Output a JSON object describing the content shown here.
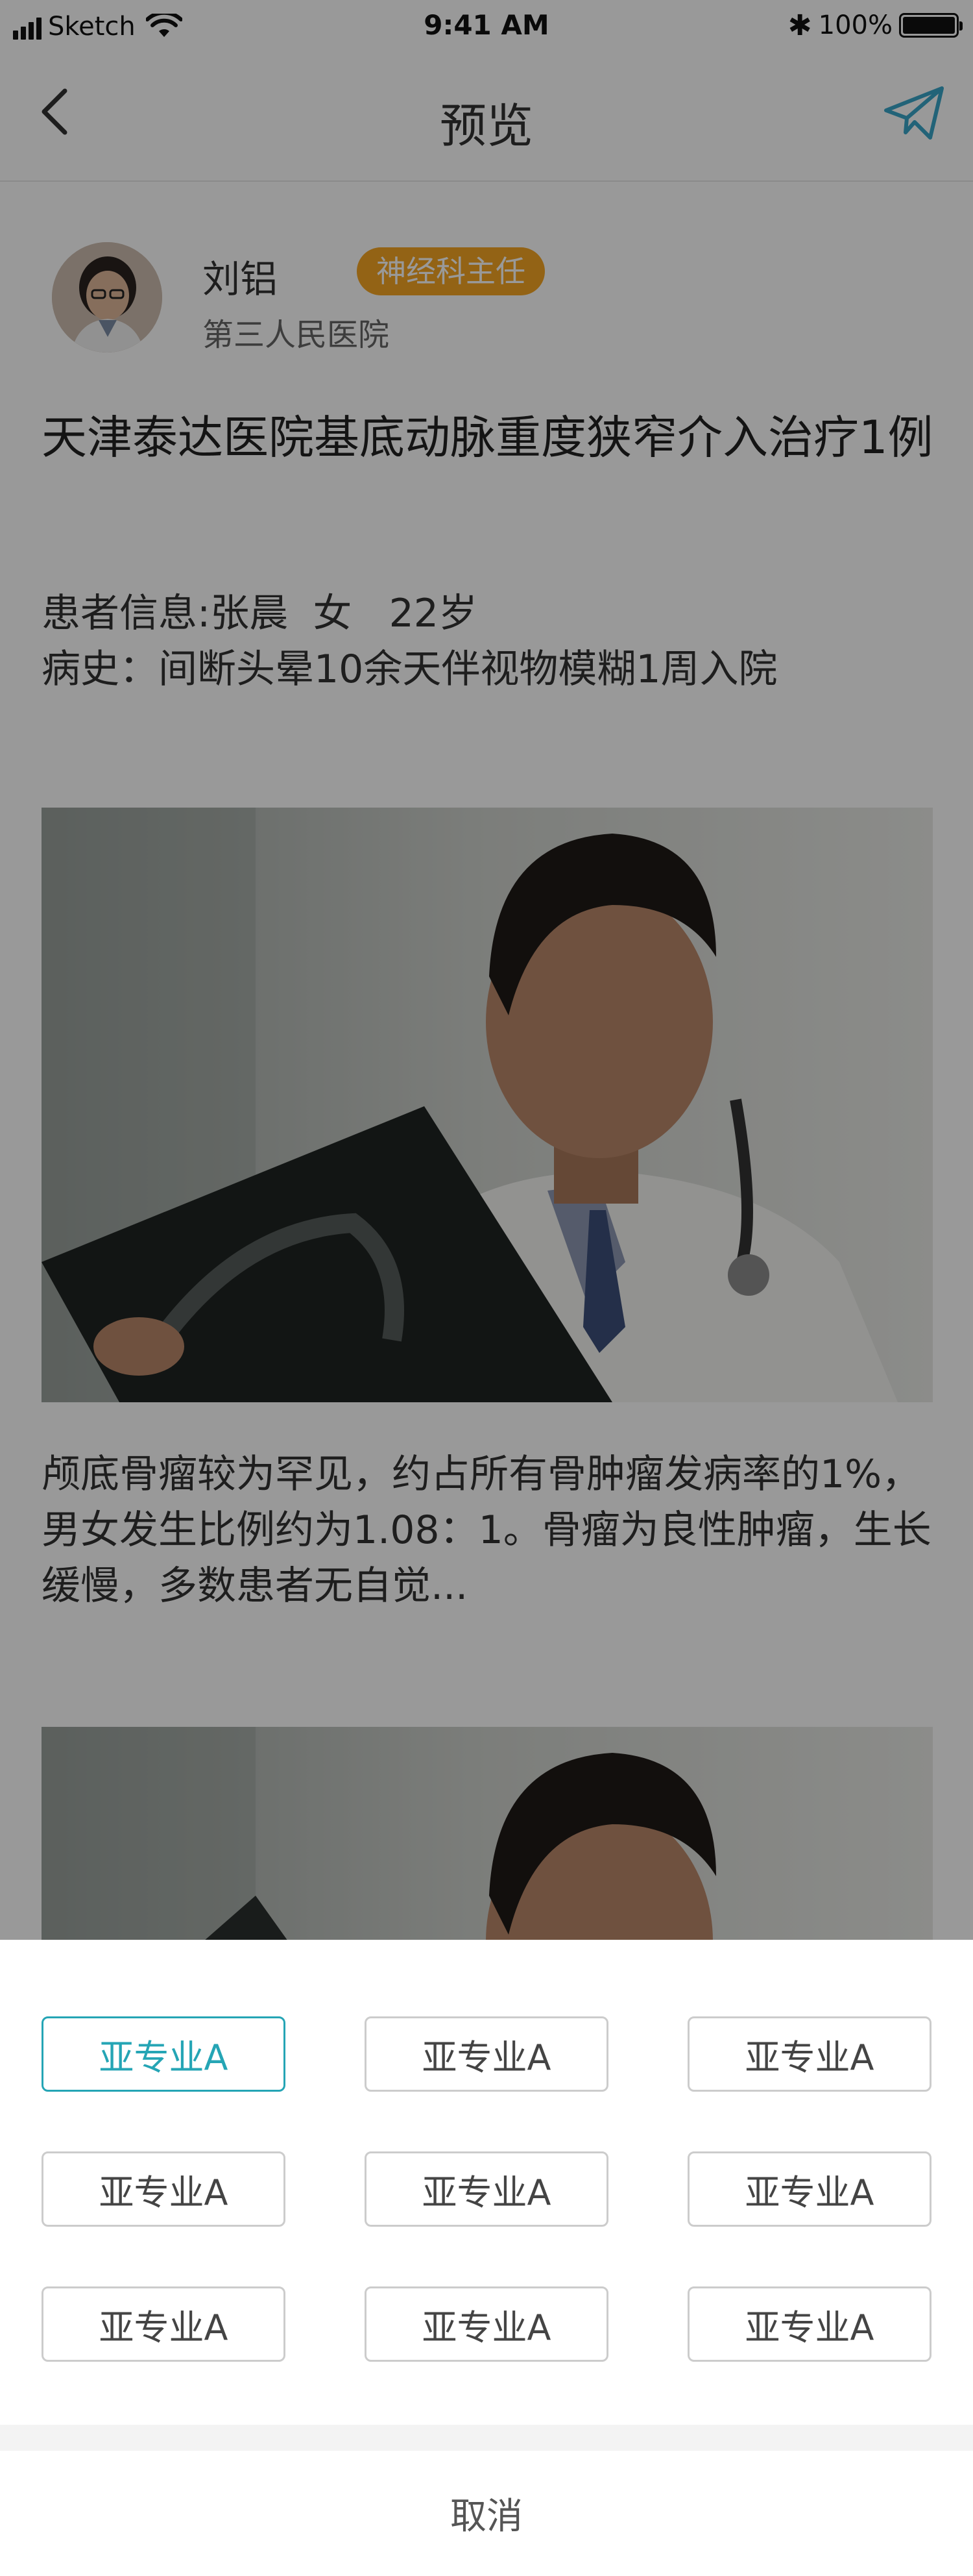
{
  "status_bar": {
    "carrier": "Sketch",
    "time": "9:41 AM",
    "battery": "100%",
    "battery_level": 1.0,
    "icons": [
      "signal-icon",
      "wifi-icon",
      "bluetooth-icon",
      "battery-icon"
    ]
  },
  "nav": {
    "title": "预览",
    "back_icon": "chevron-left-icon",
    "send_icon": "paper-plane-icon",
    "accent_color": "#3aa6c9"
  },
  "author": {
    "name": "刘铝",
    "title_badge": "神经科主任",
    "hospital": "第三人民医院",
    "badge_color": "#f5a623"
  },
  "article": {
    "title": "天津泰达医院基底动脉重度狭窄介入治疗1例",
    "patient_info": "患者信息:张晨  女   22岁",
    "history": "病史：间断头晕10余天伴视物模糊1周入院",
    "body": "颅底骨瘤较为罕见，约占所有骨肿瘤发病率的1%，男女发生比例约为1.08：1。骨瘤为良性肿瘤，生长缓慢，多数患者无自觉..."
  },
  "sheet": {
    "options": [
      "亚专业A",
      "亚专业A",
      "亚专业A",
      "亚专业A",
      "亚专业A",
      "亚专业A",
      "亚专业A",
      "亚专业A",
      "亚专业A"
    ],
    "selected_index": 0,
    "selected_color": "#25a5b5",
    "cancel_label": "取消"
  }
}
